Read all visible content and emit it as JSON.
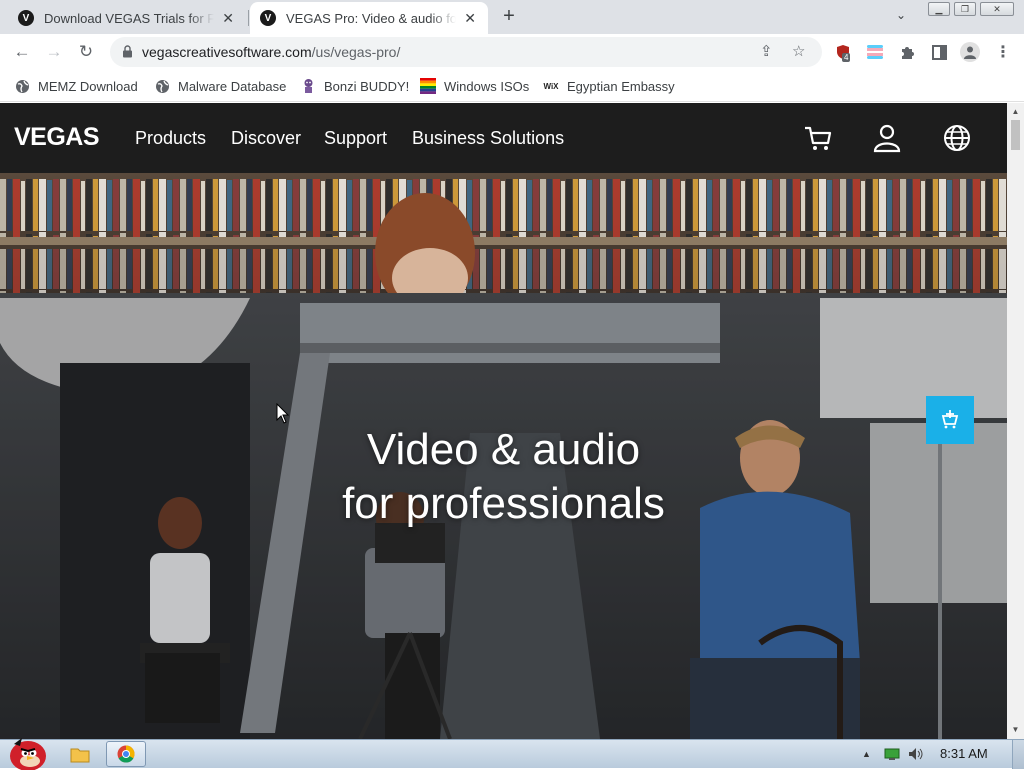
{
  "browser": {
    "tabs": [
      {
        "title": "Download VEGAS Trials for Fre",
        "favicon": "V",
        "active": false
      },
      {
        "title": "VEGAS Pro: Video & audio for",
        "favicon": "V",
        "active": true
      }
    ],
    "new_tab_label": "+",
    "tab_search_label": "⌄",
    "url_domain": "vegascreativesoftware.com",
    "url_path": "/us/vegas-pro/",
    "extension_badge": "4",
    "bookmarks": [
      {
        "label": "MEMZ Download",
        "icon": "globe-icon"
      },
      {
        "label": "Malware Database",
        "icon": "globe-icon"
      },
      {
        "label": "Bonzi BUDDY!",
        "icon": "bonzi-icon"
      },
      {
        "label": "Windows ISOs",
        "icon": "windows-icon"
      },
      {
        "label": "Egyptian Embassy",
        "icon": "wix-icon"
      }
    ]
  },
  "site": {
    "logo": "VEGAS",
    "nav": [
      "Products",
      "Discover",
      "Support",
      "Business Solutions"
    ],
    "hero_title_line1": "Video & audio",
    "hero_title_line2": "for professionals",
    "accent_color": "#1ab0e8"
  },
  "taskbar": {
    "clock": "8:31 AM"
  }
}
